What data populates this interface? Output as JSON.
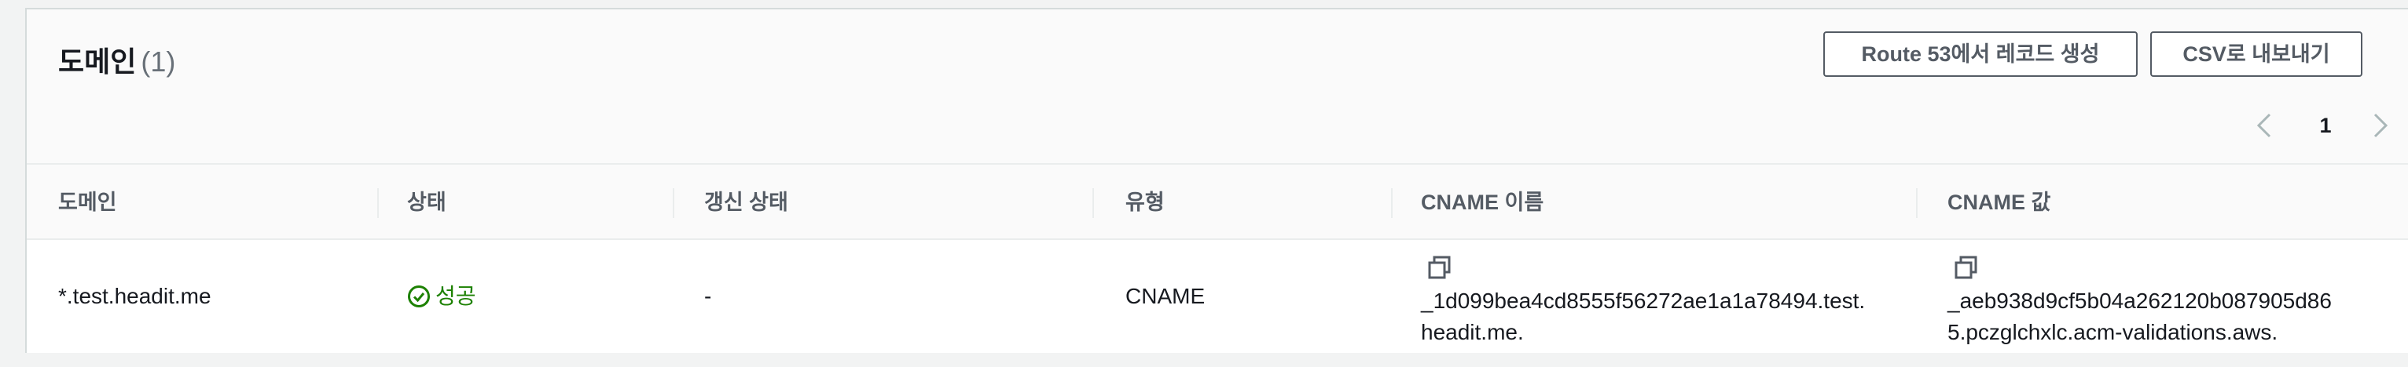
{
  "header": {
    "title": "도메인",
    "count": "(1)",
    "route53_button_label": "Route 53에서 레코드 생성",
    "csv_button_label": "CSV로 내보내기"
  },
  "pagination": {
    "current_page": "1",
    "prev_icon": "chevron-left-icon",
    "next_icon": "chevron-right-icon"
  },
  "table": {
    "columns": [
      "도메인",
      "상태",
      "갱신 상태",
      "유형",
      "CNAME 이름",
      "CNAME 값"
    ],
    "rows": [
      {
        "domain": "*.test.headit.me",
        "status": "성공",
        "renewal_status": "-",
        "type": "CNAME",
        "cname_name": "_1d099bea4cd8555f56272ae1a1a78494.test.\nheadit.me.",
        "cname_value": "_aeb938d9cf5b04a262120b087905d86\n5.pczglchxlc.acm-validations.aws."
      }
    ]
  },
  "colors": {
    "success": "#1d8102",
    "button_border": "#545b64",
    "header_bg": "#fafafa"
  }
}
